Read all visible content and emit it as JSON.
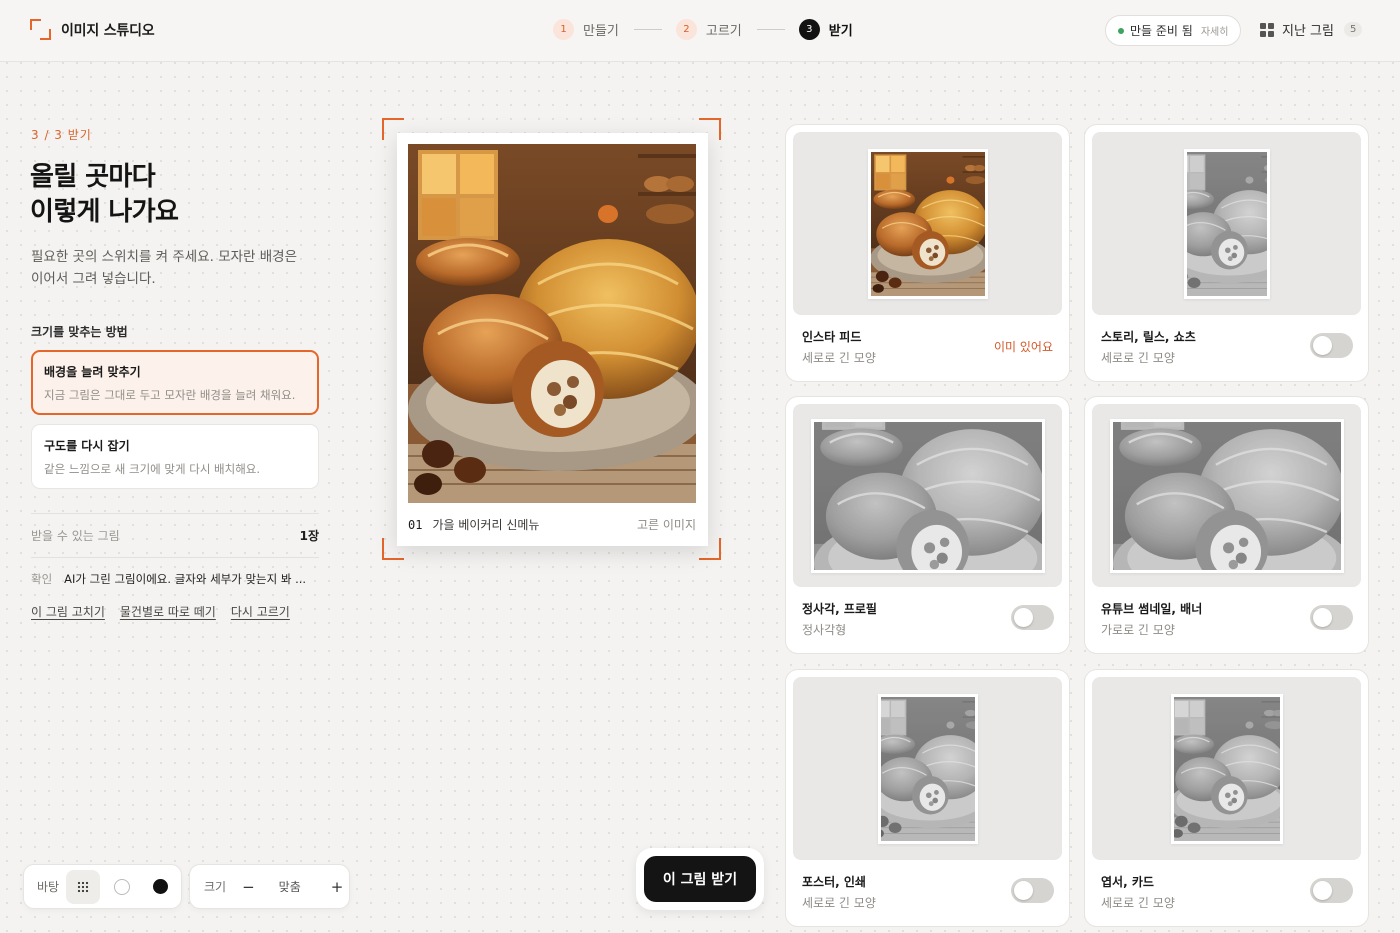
{
  "app": {
    "title": "이미지 스튜디오"
  },
  "steps": [
    {
      "num": "1",
      "label": "만들기",
      "active": false
    },
    {
      "num": "2",
      "label": "고르기",
      "active": false
    },
    {
      "num": "3",
      "label": "받기",
      "active": true
    }
  ],
  "status": {
    "label": "만들 준비 됨",
    "detail": "자세히"
  },
  "history": {
    "label": "지난 그림",
    "count": "5"
  },
  "left": {
    "breadcrumb": "3 / 3 받기",
    "headline_line1": "올릴 곳마다",
    "headline_line2": "이렇게 나가요",
    "description": "필요한 곳의 스위치를 켜 주세요. 모자란 배경은 이어서 그려 넣습니다.",
    "method_title": "크기를 맞추는 방법",
    "options": [
      {
        "title": "배경을 늘려 맞추기",
        "desc": "지금 그림은 그대로 두고 모자란 배경을 늘려 채워요.",
        "selected": true
      },
      {
        "title": "구도를 다시 잡기",
        "desc": "같은 느낌으로 새 크기에 맞게 다시 배치해요.",
        "selected": false
      }
    ],
    "available_label": "받을 수 있는 그림",
    "available_value": "1장",
    "confirm_label": "확인",
    "confirm_text": "AI가 그린 그림이에요. 글자와 세부가 맞는지 봐 ...",
    "links": [
      "이 그림 고치기",
      "물건별로 따로 떼기",
      "다시 고르기"
    ]
  },
  "toolbar": {
    "background_label": "바탕",
    "size_label": "크기",
    "minus": "−",
    "fit": "맞춤",
    "plus": "+"
  },
  "preview": {
    "number": "01",
    "title": "가을 베이커리 신메뉴",
    "tag": "고른 이미지"
  },
  "action": {
    "download_label": "이 그림 받기"
  },
  "formats": [
    {
      "title": "인스타 피드",
      "subtitle": "세로로 긴 모양",
      "status": "이미 있어요",
      "enabled": true
    },
    {
      "title": "스토리, 릴스, 쇼츠",
      "subtitle": "세로로 긴 모양",
      "enabled": false
    },
    {
      "title": "정사각, 프로필",
      "subtitle": "정사각형",
      "enabled": false
    },
    {
      "title": "유튜브 썸네일, 배너",
      "subtitle": "가로로 긴 모양",
      "enabled": false
    },
    {
      "title": "포스터, 인쇄",
      "subtitle": "세로로 긴 모양",
      "enabled": false
    },
    {
      "title": "엽서, 카드",
      "subtitle": "세로로 긴 모양",
      "enabled": false
    }
  ],
  "colors": {
    "accent": "#e4662a",
    "ready": "#3da35d",
    "dark": "#141414"
  }
}
